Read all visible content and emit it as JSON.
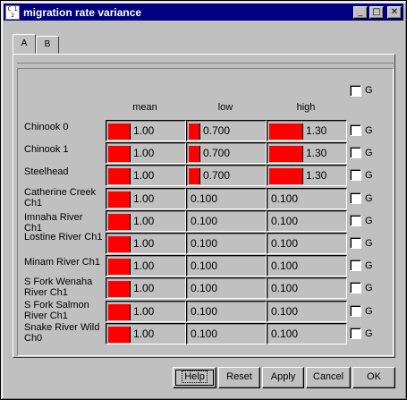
{
  "window": {
    "title": "migration rate variance",
    "icon_text": "C 1 2"
  },
  "title_buttons": {
    "minimize": "_",
    "maximize": "□",
    "close": "✕"
  },
  "tabs": [
    {
      "label": "A"
    },
    {
      "label": "B"
    }
  ],
  "columns": {
    "mean": "mean",
    "low": "low",
    "high": "high"
  },
  "global_toggle": {
    "label": "G",
    "checked": false
  },
  "rows": [
    {
      "label": "Chinook 0",
      "mean": "1.00",
      "low": "0.700",
      "high": "1.30",
      "mean_fill": 0.3,
      "low_fill": 0.15,
      "high_fill": 0.45,
      "g": "G"
    },
    {
      "label": "Chinook 1",
      "mean": "1.00",
      "low": "0.700",
      "high": "1.30",
      "mean_fill": 0.3,
      "low_fill": 0.15,
      "high_fill": 0.45,
      "g": "G"
    },
    {
      "label": "Steelhead",
      "mean": "1.00",
      "low": "0.700",
      "high": "1.30",
      "mean_fill": 0.3,
      "low_fill": 0.15,
      "high_fill": 0.45,
      "g": "G"
    },
    {
      "label": "Catherine Creek Ch1",
      "mean": "1.00",
      "low": "0.100",
      "high": "0.100",
      "mean_fill": 0.3,
      "low_fill": 0,
      "high_fill": 0,
      "g": "G"
    },
    {
      "label": "Imnaha River Ch1",
      "mean": "1.00",
      "low": "0.100",
      "high": "0.100",
      "mean_fill": 0.3,
      "low_fill": 0,
      "high_fill": 0,
      "g": "G"
    },
    {
      "label": "Lostine River Ch1",
      "mean": "1.00",
      "low": "0.100",
      "high": "0.100",
      "mean_fill": 0.3,
      "low_fill": 0,
      "high_fill": 0,
      "g": "G"
    },
    {
      "label": "Minam River Ch1",
      "mean": "1.00",
      "low": "0.100",
      "high": "0.100",
      "mean_fill": 0.3,
      "low_fill": 0,
      "high_fill": 0,
      "g": "G"
    },
    {
      "label": "S Fork Wenaha River Ch1",
      "mean": "1.00",
      "low": "0.100",
      "high": "0.100",
      "mean_fill": 0.3,
      "low_fill": 0,
      "high_fill": 0,
      "g": "G"
    },
    {
      "label": "S Fork Salmon River Ch1",
      "mean": "1.00",
      "low": "0.100",
      "high": "0.100",
      "mean_fill": 0.3,
      "low_fill": 0,
      "high_fill": 0,
      "g": "G"
    },
    {
      "label": "Snake River Wild Ch0",
      "mean": "1.00",
      "low": "0.100",
      "high": "0.100",
      "mean_fill": 0.3,
      "low_fill": 0,
      "high_fill": 0,
      "g": "G"
    }
  ],
  "buttons": {
    "help": "Help",
    "reset": "Reset",
    "apply": "Apply",
    "cancel": "Cancel",
    "ok": "OK"
  },
  "colors": {
    "bar": "#ff0000",
    "title_bar": "#000080",
    "face": "#c0c0c0"
  }
}
